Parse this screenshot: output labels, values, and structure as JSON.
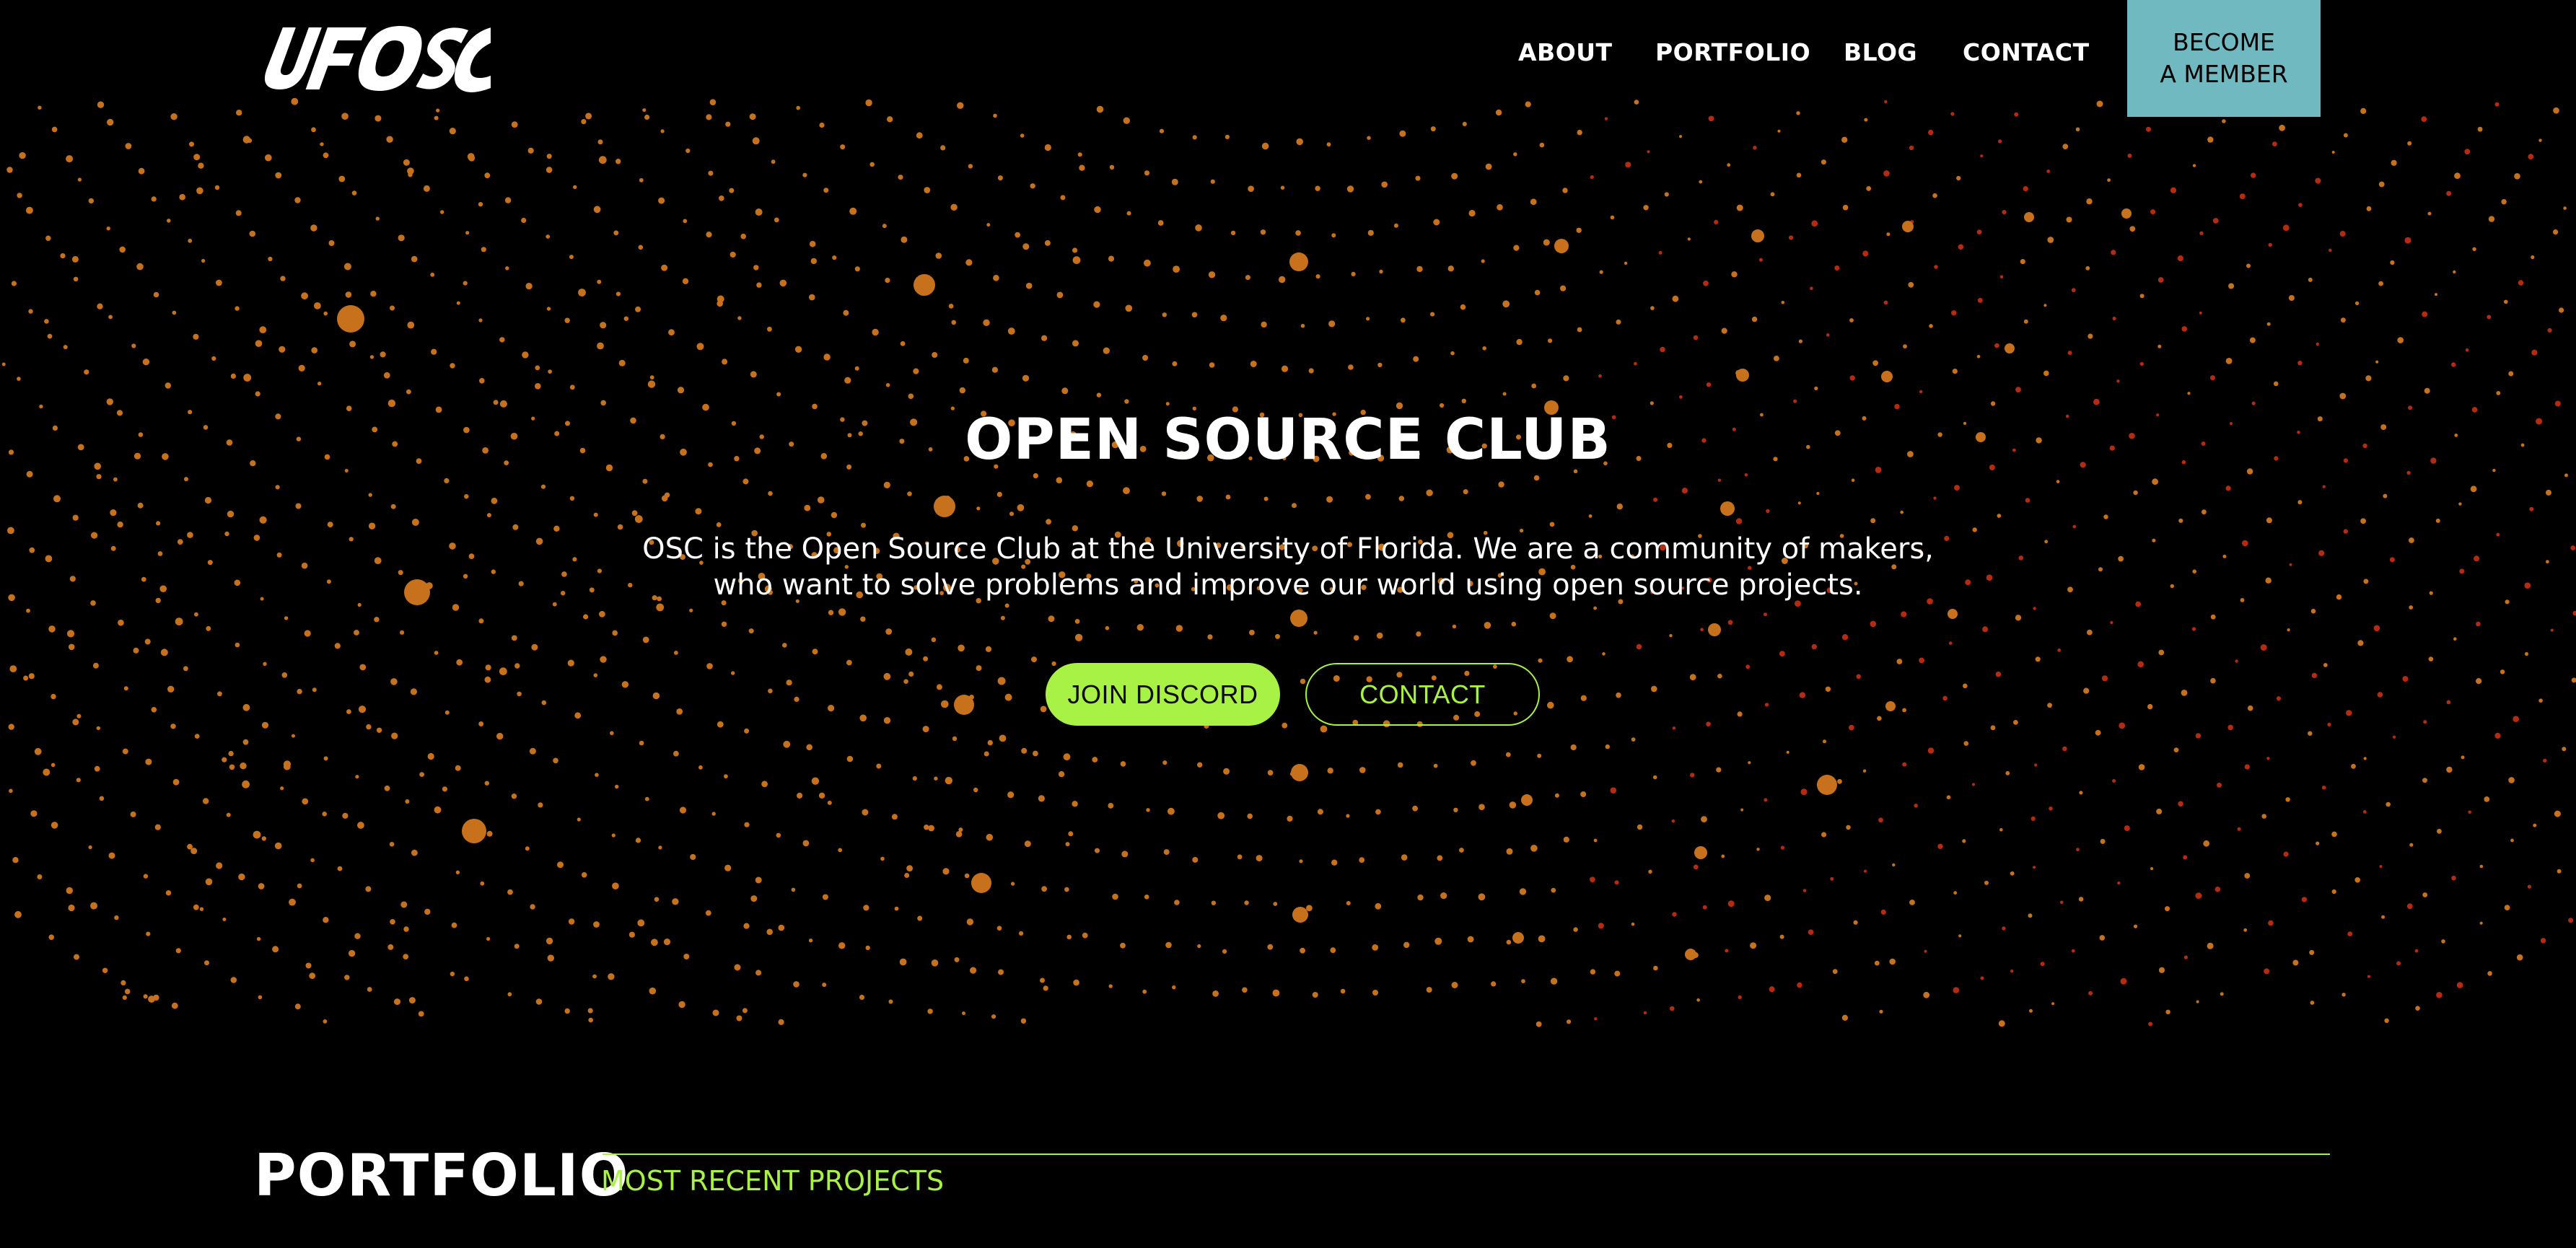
{
  "header": {
    "logo_text": "UF OSC",
    "nav": [
      {
        "label": "ABOUT"
      },
      {
        "label": "PORTFOLIO"
      },
      {
        "label": "BLOG"
      },
      {
        "label": "CONTACT"
      }
    ],
    "member_button": {
      "line1": "BECOME",
      "line2": "A MEMBER"
    }
  },
  "hero": {
    "title": "OPEN SOURCE CLUB",
    "description_line1": "OSC is the Open Source Club at the University of Florida. We are a community of makers,",
    "description_line2": "who want to solve problems and improve our world using open source projects.",
    "primary_button": "JOIN DISCORD",
    "secondary_button": "CONTACT"
  },
  "portfolio": {
    "title": "PORTFOLIO",
    "subtitle": "MOST RECENT PROJECTS"
  },
  "colors": {
    "background": "#000000",
    "accent_green": "#a8f145",
    "member_teal": "#71b9c0",
    "particle_orange": "#c8711d",
    "particle_red": "#b52a10",
    "text": "#ffffff"
  }
}
